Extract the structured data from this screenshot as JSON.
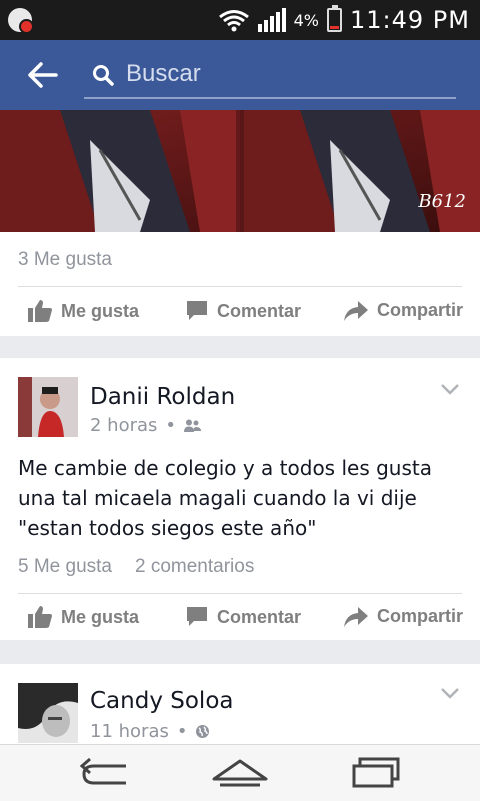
{
  "status_bar": {
    "time": "11:49 PM",
    "battery_percent": "4%",
    "battery_level": 0.15,
    "icons": [
      "notification-app-icon",
      "wifi-icon",
      "signal-icon",
      "battery-icon"
    ]
  },
  "top_bar": {
    "search_placeholder": "Buscar",
    "bg_color": "#3b5998"
  },
  "photo": {
    "watermark": "B612"
  },
  "posts": [
    {
      "likes": "3 Me gusta",
      "actions": {
        "like": "Me gusta",
        "comment": "Comentar",
        "share": "Compartir"
      }
    },
    {
      "author": "Danii Roldan",
      "time": "2 horas",
      "audience_icon": "friends-icon",
      "text": "Me cambie de colegio y a todos les gusta una tal micaela magali cuando la vi dije \"estan todos siegos este año\"",
      "likes": "5 Me gusta",
      "comments": "2 comentarios",
      "actions": {
        "like": "Me gusta",
        "comment": "Comentar",
        "share": "Compartir"
      }
    },
    {
      "author": "Candy Soloa",
      "time": "11 horas",
      "audience_icon": "globe-icon"
    }
  ],
  "nav_bar": {
    "icons": [
      "back-nav-icon",
      "home-nav-icon",
      "recent-apps-icon"
    ]
  }
}
